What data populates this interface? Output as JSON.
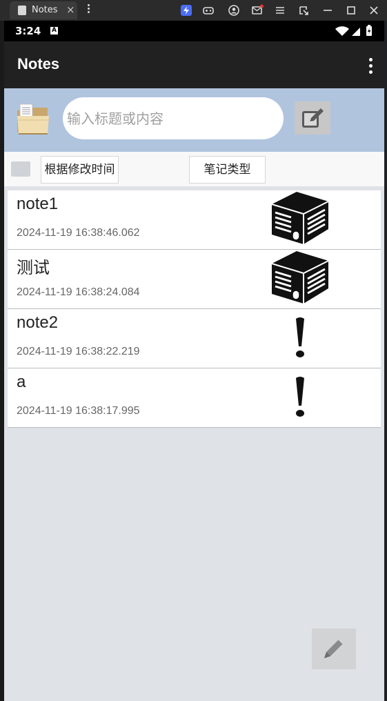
{
  "window": {
    "tab_title": "Notes",
    "close_glyph": "×"
  },
  "status_bar": {
    "time": "3:24",
    "notification_badge": "A"
  },
  "app_bar": {
    "title": "Notes"
  },
  "search": {
    "placeholder": "输入标题或内容"
  },
  "sort": {
    "modified_time_label": "根据修改时间",
    "note_type_label": "笔记类型"
  },
  "notes": [
    {
      "title": "note1",
      "time": "2024-11-19 16:38:46.062",
      "type_icon": "database-server-icon"
    },
    {
      "title": "测试",
      "time": "2024-11-19 16:38:24.084",
      "type_icon": "database-server-icon"
    },
    {
      "title": "note2",
      "time": "2024-11-19 16:38:22.219",
      "type_icon": "exclamation-icon"
    },
    {
      "title": "a",
      "time": "2024-11-19 16:38:17.995",
      "type_icon": "exclamation-icon"
    }
  ],
  "colors": {
    "app_bar": "#212121",
    "search_bar": "#b0c4de",
    "list_background": "#dfe2e6"
  }
}
